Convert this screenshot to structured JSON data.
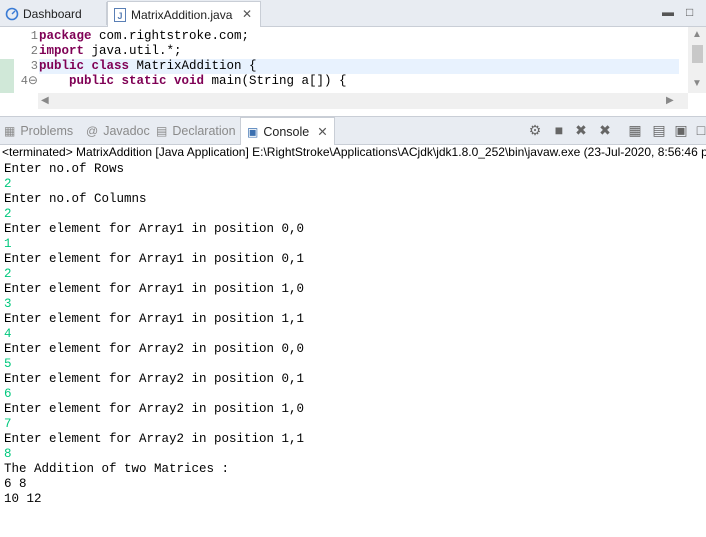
{
  "editor_tabs": [
    {
      "label": "Dashboard",
      "icon": "dashboard-icon"
    },
    {
      "label": "MatrixAddition.java",
      "icon": "java-file-icon"
    }
  ],
  "editor": {
    "lines": [
      {
        "num": "1",
        "parts": [
          {
            "t": "package",
            "kw": true
          },
          {
            "t": " com.rightstroke.com;",
            "kw": false
          }
        ]
      },
      {
        "num": "2",
        "parts": [
          {
            "t": "import",
            "kw": true
          },
          {
            "t": " java.util.*;",
            "kw": false
          }
        ]
      },
      {
        "num": "3",
        "parts": [
          {
            "t": "public class",
            "kw": true
          },
          {
            "t": " MatrixAddition {",
            "kw": false
          }
        ]
      },
      {
        "num": "4⊖",
        "parts": [
          {
            "t": "    public static void",
            "kw": true
          },
          {
            "t": " main(String a[]) {",
            "kw": false
          }
        ]
      }
    ]
  },
  "view_tabs": [
    {
      "label": "Problems",
      "icon": "problems-icon"
    },
    {
      "label": "Javadoc",
      "icon": "javadoc-icon"
    },
    {
      "label": "Declaration",
      "icon": "declaration-icon"
    },
    {
      "label": "Console",
      "icon": "console-icon"
    }
  ],
  "console": {
    "header": "<terminated> MatrixAddition [Java Application] E:\\RightStroke\\Applications\\ACjdk\\jdk1.8.0_252\\bin\\javaw.exe  (23-Jul-2020, 8:56:46 p",
    "lines": [
      {
        "text": "Enter no.of Rows",
        "type": "prompt"
      },
      {
        "text": "2",
        "type": "input"
      },
      {
        "text": "Enter no.of Columns",
        "type": "prompt"
      },
      {
        "text": "2",
        "type": "input"
      },
      {
        "text": "Enter element for Array1 in position 0,0",
        "type": "prompt"
      },
      {
        "text": "1",
        "type": "input"
      },
      {
        "text": "Enter element for Array1 in position 0,1",
        "type": "prompt"
      },
      {
        "text": "2",
        "type": "input"
      },
      {
        "text": "Enter element for Array1 in position 1,0",
        "type": "prompt"
      },
      {
        "text": "3",
        "type": "input"
      },
      {
        "text": "Enter element for Array1 in position 1,1",
        "type": "prompt"
      },
      {
        "text": "4",
        "type": "input"
      },
      {
        "text": "Enter element for Array2 in position 0,0",
        "type": "prompt"
      },
      {
        "text": "5",
        "type": "input"
      },
      {
        "text": "Enter element for Array2 in position 0,1",
        "type": "prompt"
      },
      {
        "text": "6",
        "type": "input"
      },
      {
        "text": "Enter element for Array2 in position 1,0",
        "type": "prompt"
      },
      {
        "text": "7",
        "type": "input"
      },
      {
        "text": "Enter element for Array2 in position 1,1",
        "type": "prompt"
      },
      {
        "text": "8",
        "type": "input"
      },
      {
        "text": "The Addition of two Matrices :",
        "type": "prompt"
      },
      {
        "text": "6 8",
        "type": "prompt"
      },
      {
        "text": "10 12",
        "type": "prompt"
      }
    ]
  },
  "colors": {
    "keyword": "#7f0055",
    "console_input": "#00c87d",
    "current_line": "#e8f2fe"
  }
}
